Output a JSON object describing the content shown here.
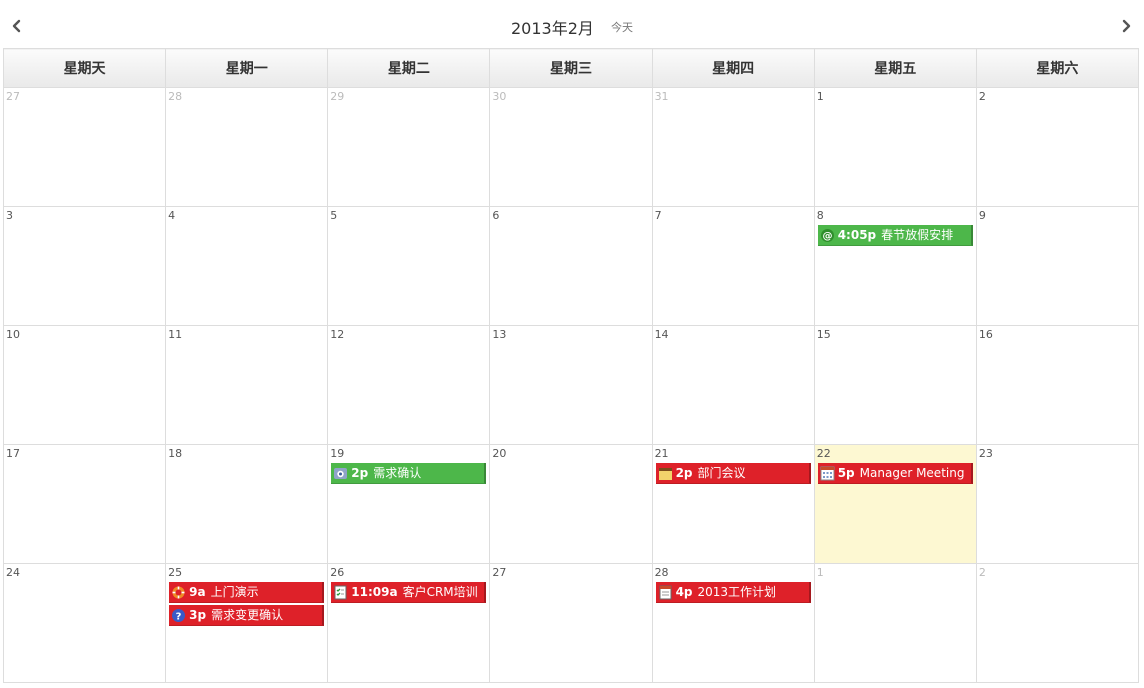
{
  "header": {
    "title": "2013年2月",
    "today_label": "今天",
    "prev_icon": "chevron-left-icon",
    "next_icon": "chevron-right-icon"
  },
  "weekdays": [
    "星期天",
    "星期一",
    "星期二",
    "星期三",
    "星期四",
    "星期五",
    "星期六"
  ],
  "weeks": [
    {
      "days": [
        "27",
        "28",
        "29",
        "30",
        "31",
        "1",
        "2"
      ]
    },
    {
      "days": [
        "3",
        "4",
        "5",
        "6",
        "7",
        "8",
        "9"
      ]
    },
    {
      "days": [
        "10",
        "11",
        "12",
        "13",
        "14",
        "15",
        "16"
      ]
    },
    {
      "days": [
        "17",
        "18",
        "19",
        "20",
        "21",
        "22",
        "23"
      ]
    },
    {
      "days": [
        "24",
        "25",
        "26",
        "27",
        "28",
        "1",
        "2"
      ]
    }
  ],
  "events": {
    "feb8": {
      "time": "4:05p",
      "title": "春节放假安排",
      "color": "#4db74a",
      "icon": "at-sign-icon"
    },
    "feb19": {
      "time": "2p",
      "title": "需求确认",
      "color": "#4db74a",
      "icon": "phone-icon"
    },
    "feb21": {
      "time": "2p",
      "title": "部门会议",
      "color": "#de2129",
      "icon": "folder-icon"
    },
    "feb22": {
      "time": "5p",
      "title": "Manager Meeting",
      "color": "#de2129",
      "icon": "calendar-grid-icon"
    },
    "feb25a": {
      "time": "9a",
      "title": "上门演示",
      "color": "#de2129",
      "icon": "lifebuoy-icon"
    },
    "feb25b": {
      "time": "3p",
      "title": "需求变更确认",
      "color": "#de2129",
      "icon": "question-icon"
    },
    "feb26": {
      "time": "11:09a",
      "title": "客户CRM培训",
      "color": "#de2129",
      "icon": "checklist-icon"
    },
    "feb28": {
      "time": "4p",
      "title": "2013工作计划",
      "color": "#de2129",
      "icon": "calendar-page-icon"
    }
  },
  "colors": {
    "today_highlight": "#fdf8d2",
    "border": "#dddddd",
    "event_green": "#4db74a",
    "event_red": "#de2129"
  }
}
